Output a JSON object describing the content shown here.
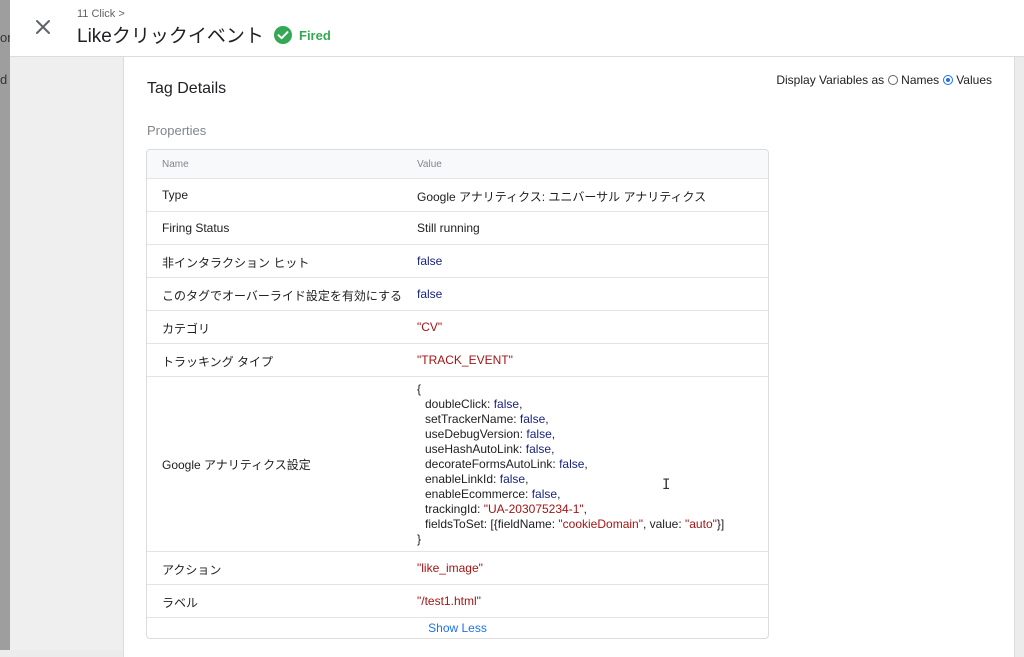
{
  "background": {
    "letters": [
      "or",
      "d"
    ]
  },
  "header": {
    "breadcrumb": "11 Click >",
    "title": "Likeクリックイベント",
    "status": "Fired",
    "status_color": "#34a853",
    "close_icon": "close-icon"
  },
  "tag_details": {
    "title": "Tag Details",
    "display_variables": {
      "label": "Display Variables as",
      "options": [
        "Names",
        "Values"
      ],
      "selected": "Values"
    },
    "section": "Properties",
    "columns": [
      "Name",
      "Value"
    ],
    "rows": [
      {
        "name": "Type",
        "value": "Google アナリティクス: ユニバーサル アナリティクス"
      },
      {
        "name": "Firing Status",
        "value": "Still running"
      },
      {
        "name": "非インタラクション ヒット",
        "value": "false"
      },
      {
        "name": "このタグでオーバーライド設定を有効にする",
        "value": "false"
      },
      {
        "name": "カテゴリ",
        "value": "\"CV\""
      },
      {
        "name": "トラッキング タイプ",
        "value": "\"TRACK_EVENT\""
      },
      {
        "name": "Google アナリティクス設定",
        "value": {
          "open": "{",
          "lines": [
            {
              "key": "doubleClick: ",
              "val": "false",
              "end": ","
            },
            {
              "key": "setTrackerName: ",
              "val": "false",
              "end": ","
            },
            {
              "key": "useDebugVersion: ",
              "val": "false",
              "end": ","
            },
            {
              "key": "useHashAutoLink: ",
              "val": "false",
              "end": ","
            },
            {
              "key": "decorateFormsAutoLink: ",
              "val": "false",
              "end": ","
            },
            {
              "key": "enableLinkId: ",
              "val": "false",
              "end": ","
            },
            {
              "key": "enableEcommerce: ",
              "val": "false",
              "end": ","
            },
            {
              "key": "trackingId: ",
              "val": "\"UA-203075234-1\"",
              "end": ","
            }
          ],
          "fields_line": {
            "prefix": "fieldsToSet: [{fieldName: ",
            "field_name": "\"cookieDomain\"",
            "mid": ", value: ",
            "field_value": "\"auto\"",
            "suffix": "}]"
          },
          "close": "}"
        }
      },
      {
        "name": "アクション",
        "value": "\"like_image\""
      },
      {
        "name": "ラベル",
        "value": "\"/test1.html\""
      }
    ],
    "show_less": "Show Less"
  }
}
